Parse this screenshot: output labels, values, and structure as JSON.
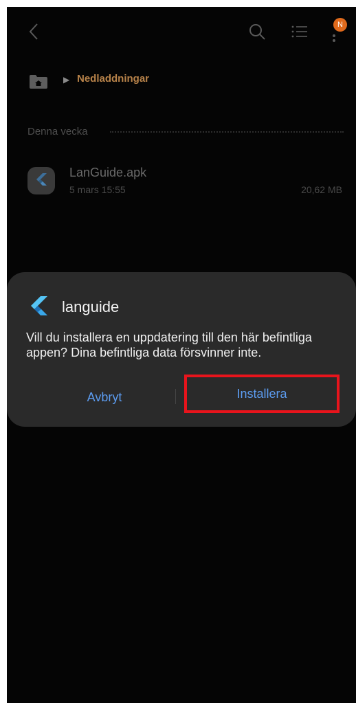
{
  "top_bar": {
    "back_icon": "chevron-left",
    "search_icon": "search",
    "list_view_icon": "list",
    "more_icon": "vertical-dots",
    "badge_text": "N"
  },
  "breadcrumb": {
    "home_icon": "home-folder",
    "current": "Nedladdningar"
  },
  "section": {
    "label": "Denna vecka"
  },
  "file": {
    "name": "LanGuide.apk",
    "date": "5 mars 15:55",
    "size": "20,62 MB",
    "icon": "flutter-logo"
  },
  "dialog": {
    "app_name": "languide",
    "message": "Vill du installera en uppdatering till den här befintliga appen? Dina befintliga data försvinner inte.",
    "cancel_label": "Avbryt",
    "install_label": "Installera"
  },
  "colors": {
    "background": "#050505",
    "dialog": "#2a2a2a",
    "accent": "#5c9cf0",
    "breadcrumb": "#b8834a",
    "badge": "#e06a1c",
    "highlight": "#e8141c"
  }
}
